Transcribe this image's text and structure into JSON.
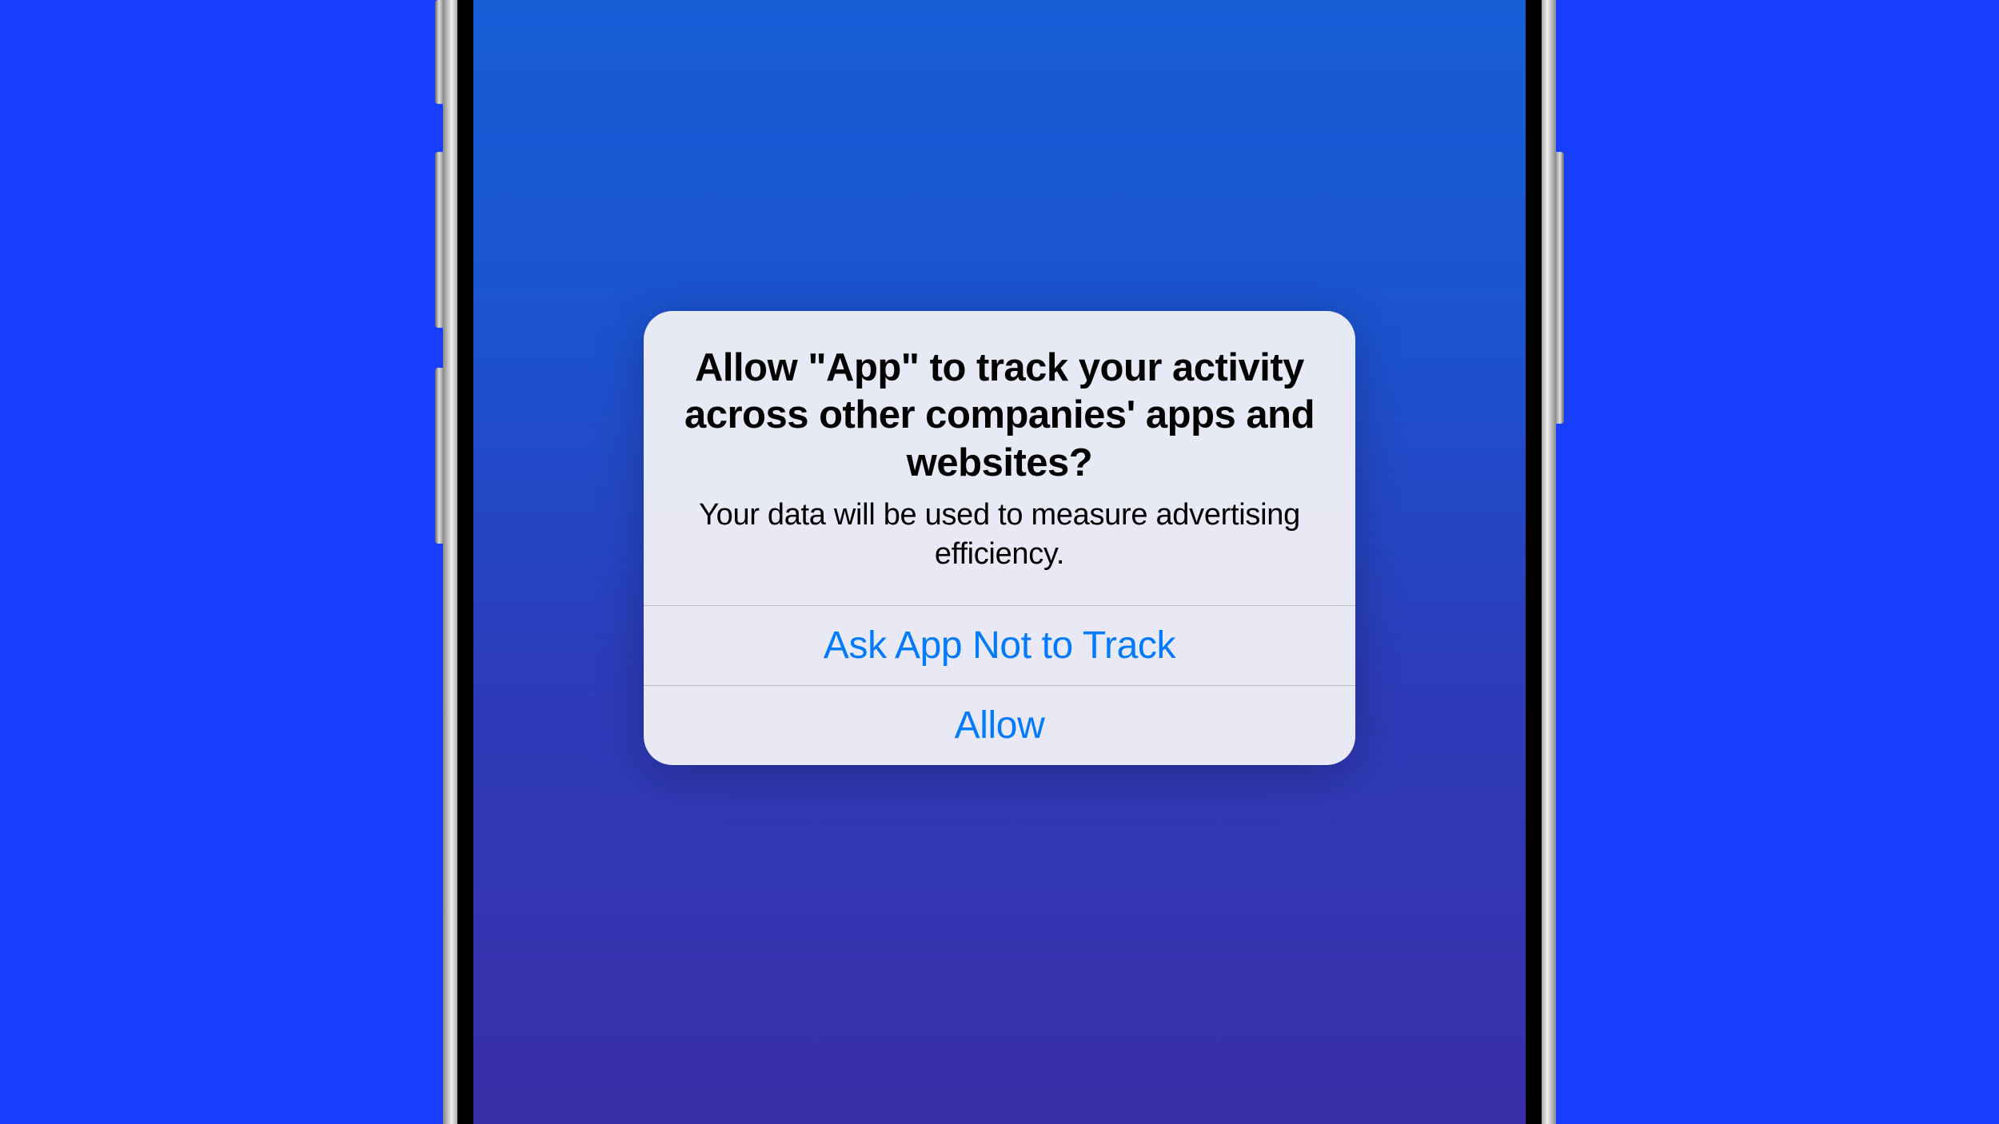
{
  "alert": {
    "title": "Allow \"App\" to track your activity across other companies' apps and websites?",
    "description": "Your data will be used to measure advertising efficiency.",
    "buttons": {
      "deny_label": "Ask App Not to Track",
      "allow_label": "Allow"
    }
  }
}
